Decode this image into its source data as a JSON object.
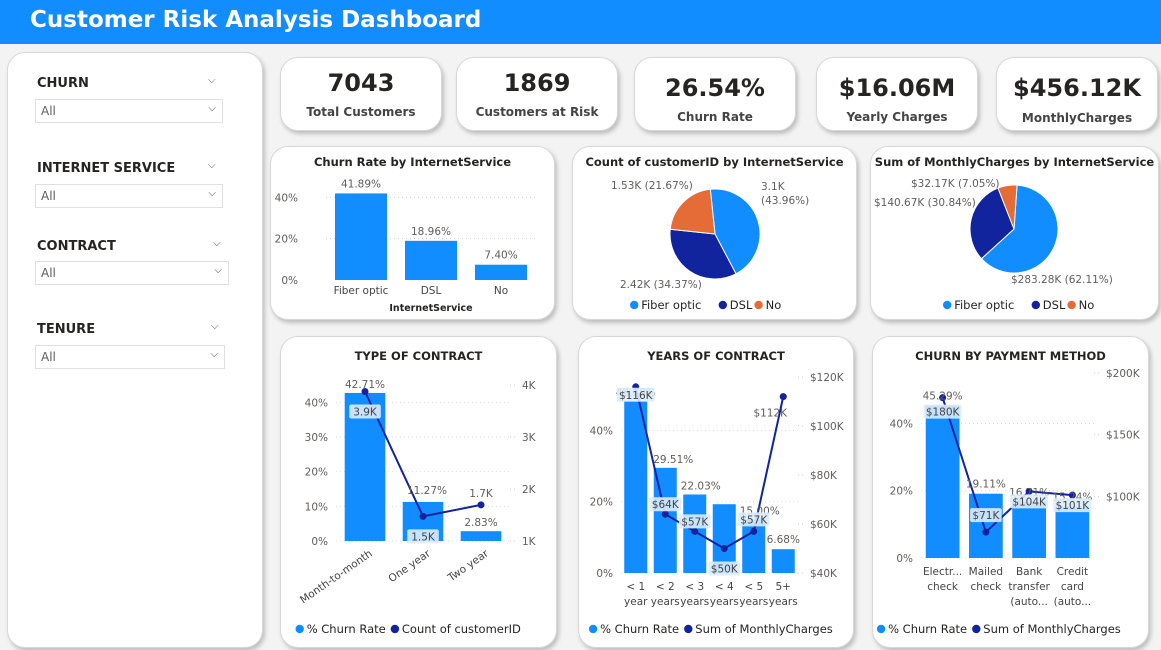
{
  "title": "Customer Risk Analysis Dashboard",
  "filters": [
    {
      "label": "CHURN",
      "value": "All"
    },
    {
      "label": "INTERNET SERVICE",
      "value": "All"
    },
    {
      "label": "CONTRACT",
      "value": "All"
    },
    {
      "label": "TENURE",
      "value": "All"
    }
  ],
  "kpis": [
    {
      "value": "7043",
      "label": "Total Customers"
    },
    {
      "value": "1869",
      "label": "Customers at Risk"
    },
    {
      "value": "26.54%",
      "label": "Churn Rate"
    },
    {
      "value": "$16.06M",
      "label": "Yearly Charges"
    },
    {
      "value": "$456.12K",
      "label": "MonthlyCharges"
    }
  ],
  "colors": {
    "blue": "#118DFF",
    "navy": "#12239E",
    "orange": "#E66C37",
    "banner": "#118DFF"
  },
  "chart_data": [
    {
      "type": "bar",
      "title": "Churn Rate by InternetService",
      "xlabel": "InternetService",
      "categories": [
        "Fiber optic",
        "DSL",
        "No"
      ],
      "values": [
        41.89,
        18.96,
        7.4
      ],
      "labels": [
        "41.89%",
        "18.96%",
        "7.40%"
      ],
      "yticks": [
        "40%",
        "20%",
        "0%"
      ],
      "ylim": [
        0,
        45
      ]
    },
    {
      "type": "pie",
      "title": "Count of customerID by InternetService",
      "slices": [
        {
          "name": "Fiber optic",
          "value": 3096,
          "label": "3.1K (43.96%)"
        },
        {
          "name": "DSL",
          "value": 2421,
          "label": "2.42K (34.37%)"
        },
        {
          "name": "No",
          "value": 1526,
          "label": "1.53K (21.67%)"
        }
      ],
      "legend": [
        "Fiber optic",
        "DSL",
        "No"
      ]
    },
    {
      "type": "pie",
      "title": "Sum of MonthlyCharges by InternetService",
      "slices": [
        {
          "name": "Fiber optic",
          "value": 283.28,
          "label": "$283.28K (62.11%)"
        },
        {
          "name": "DSL",
          "value": 140.67,
          "label": "$140.67K (30.84%)"
        },
        {
          "name": "No",
          "value": 32.17,
          "label": "$32.17K (7.05%)"
        }
      ],
      "legend": [
        "Fiber optic",
        "DSL",
        "No"
      ]
    },
    {
      "type": "bar",
      "title": "TYPE OF CONTRACT",
      "categories": [
        "Month-to-month",
        "One year",
        "Two year"
      ],
      "series": [
        {
          "name": "% Churn Rate",
          "values": [
            42.71,
            11.27,
            2.83
          ],
          "labels": [
            "42.71%",
            "11.27%",
            "2.83%"
          ]
        },
        {
          "name": "Count of customerID",
          "values": [
            3875,
            1473,
            1695
          ],
          "labels": [
            "3.9K",
            "1.5K",
            "1.7K"
          ]
        }
      ],
      "yticks_left": [
        "40%",
        "30%",
        "20%",
        "10%",
        "0%"
      ],
      "yticks_right": [
        "4K",
        "3K",
        "2K",
        "1K"
      ],
      "ylim_left": [
        0,
        45
      ],
      "ylim_right": [
        1000,
        4000
      ],
      "legend": [
        "% Churn Rate",
        "Count of customerID"
      ]
    },
    {
      "type": "bar",
      "title": "YEARS OF CONTRACT",
      "categories": [
        "< 1 year",
        "< 2 years",
        "< 3 years",
        "< 4 years",
        "< 5 years",
        "5+ years"
      ],
      "series": [
        {
          "name": "% Churn Rate",
          "values": [
            48.28,
            29.51,
            22.03,
            19.3,
            15.0,
            6.68
          ],
          "labels": [
            "48.28%",
            "29.51%",
            "22.03%",
            "",
            "15.00%",
            "6.68%"
          ]
        },
        {
          "name": "Sum of MonthlyCharges",
          "values": [
            116,
            64,
            57,
            50,
            57,
            112
          ],
          "labels": [
            "$116K",
            "$64K",
            "$57K",
            "$50K",
            "$57K",
            "$112K"
          ]
        }
      ],
      "yticks_left": [
        "40%",
        "20%",
        "0%"
      ],
      "yticks_right": [
        "$120K",
        "$100K",
        "$80K",
        "$60K",
        "$40K"
      ],
      "ylim_left": [
        0,
        55
      ],
      "ylim_right": [
        40,
        120
      ],
      "legend": [
        "% Churn Rate",
        "Sum of MonthlyCharges"
      ]
    },
    {
      "type": "bar",
      "title": "CHURN BY PAYMENT METHOD",
      "categories": [
        "Electr... check",
        "Mailed check",
        "Bank transfer (auto...",
        "Credit card (auto..."
      ],
      "series": [
        {
          "name": "% Churn Rate",
          "values": [
            45.29,
            19.11,
            16.71,
            15.24
          ],
          "labels": [
            "45.29%",
            "19.11%",
            "16.71%",
            "15.24%"
          ]
        },
        {
          "name": "Sum of MonthlyCharges",
          "values": [
            180,
            71,
            104,
            101
          ],
          "labels": [
            "$180K",
            "$71K",
            "$104K",
            "$101K"
          ]
        }
      ],
      "yticks_left": [
        "40%",
        "20%",
        "0%"
      ],
      "yticks_right": [
        "$200K",
        "$150K",
        "$100K"
      ],
      "ylim_left": [
        0,
        55
      ],
      "ylim_right": [
        50,
        200
      ],
      "legend": [
        "% Churn Rate",
        "Sum of MonthlyCharges"
      ]
    }
  ]
}
